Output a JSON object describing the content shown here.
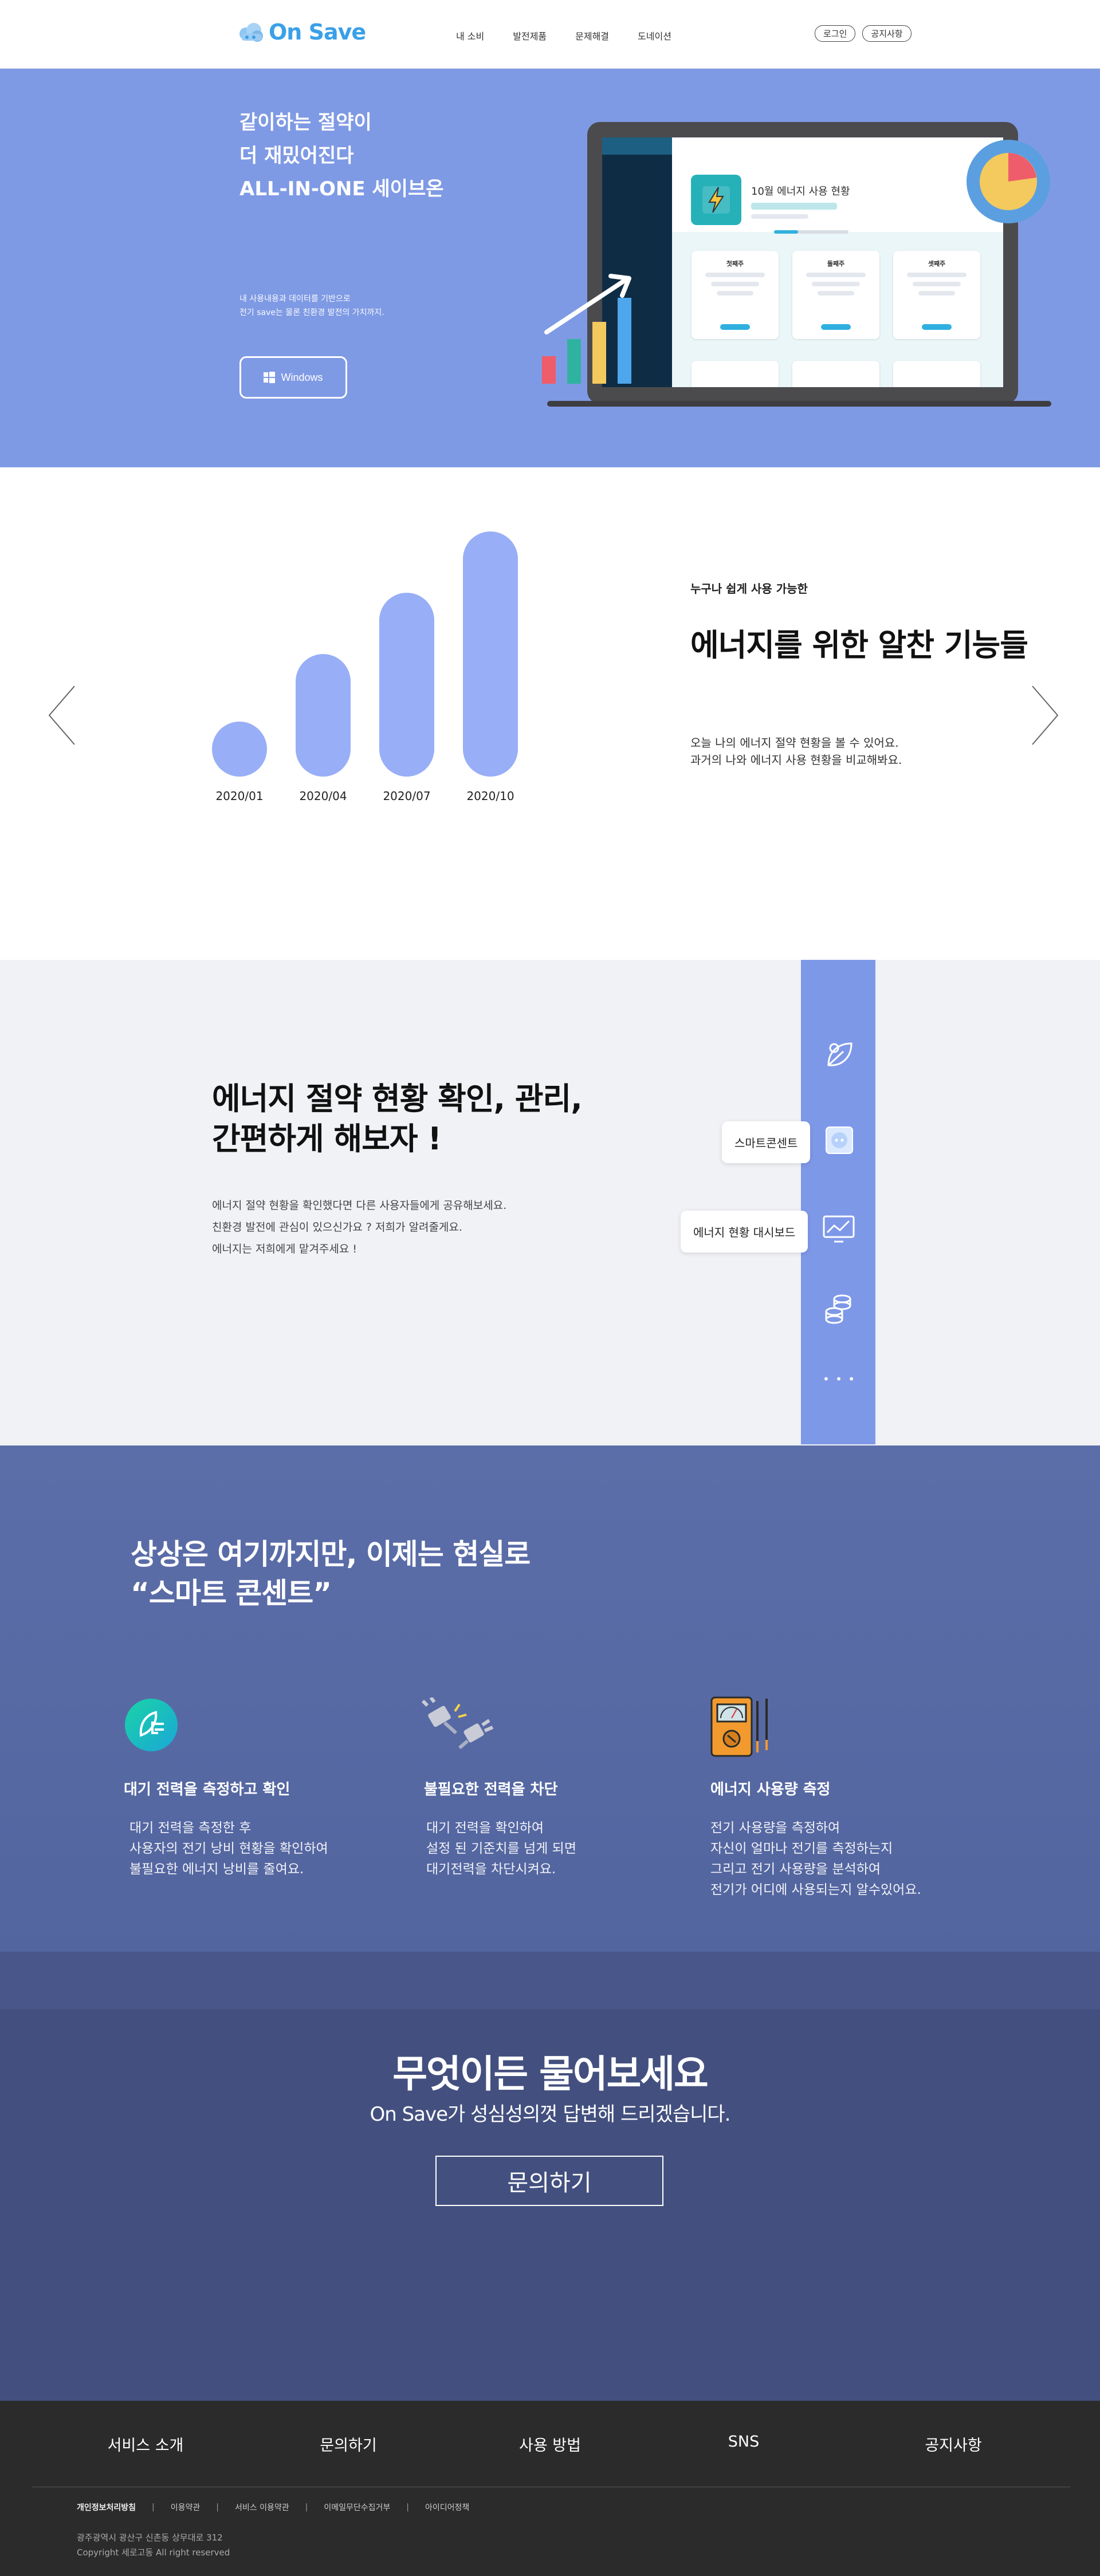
{
  "header": {
    "brand": "On Save",
    "nav": [
      "내 소비",
      "발전제품",
      "문제해결",
      "도네이션"
    ],
    "login": "로그인",
    "notice": "공지사항"
  },
  "hero": {
    "title_lines": [
      "같이하는 절약이",
      "더 재밌어진다",
      "ALL-IN-ONE 세이브온"
    ],
    "sub_lines": [
      "내 사용내용과 데이터를 기반으로",
      "전기 save는 물론 친환경 발전의 가치까지."
    ],
    "button": "Windows",
    "screen": {
      "title": "10월 에너지 사용 현황",
      "cards": [
        "첫째주",
        "둘째주",
        "셋째주"
      ]
    }
  },
  "features": {
    "kicker": "누구나 쉽게 사용 가능한",
    "title": "에너지를 위한 알찬 기능들",
    "desc_lines": [
      "오늘 나의 에너지 절약 현황을 볼 수 있어요.",
      "과거의 나와 에너지 사용 현황을 비교해봐요."
    ],
    "chart_data": {
      "type": "bar",
      "categories": [
        "2020/01",
        "2020/04",
        "2020/07",
        "2020/10"
      ],
      "values": [
        1,
        2,
        3,
        4
      ]
    }
  },
  "manage": {
    "title_lines": [
      "에너지 절약 현황 확인, 관리,",
      "간편하게 해보자 !"
    ],
    "desc_lines": [
      "에너지 절약 현황을 확인했다면 다른 사용자들에게 공유해보세요.",
      "친환경 발전에 관심이 있으신가요 ? 저희가 알려줄게요.",
      "에너지는 저희에게 맡겨주세요 !"
    ],
    "tags": [
      "스마트콘센트",
      "에너지 현황 대시보드"
    ],
    "more": "• • •"
  },
  "smart": {
    "title_lines": [
      "상상은 여기까지만, 이제는 현실로",
      "“스마트 콘센트”"
    ],
    "items": [
      {
        "title": "대기 전력을 측정하고 확인",
        "desc": [
          "대기 전력을 측정한 후",
          "사용자의 전기 낭비 현황을 확인하여",
          "불필요한 에너지 낭비를 줄여요."
        ],
        "icon": "plug-leaf-icon"
      },
      {
        "title": "불필요한 전력을 차단",
        "desc": [
          "대기 전력을 확인하여",
          "설정 된 기준치를 넘게 되면",
          "대기전력을 차단시켜요."
        ],
        "icon": "plugs-icon"
      },
      {
        "title": "에너지 사용량 측정",
        "desc": [
          "전기 사용량을 측정하여",
          "자신이 얼마나 전기를 측정하는지",
          "그리고 전기 사용량을 분석하여",
          "전기가 어디에 사용되는지 알수있어요."
        ],
        "icon": "multimeter-icon"
      }
    ]
  },
  "ask": {
    "title": "무엇이든 물어보세요",
    "sub": "On Save가 성심성의껏 답변해 드리겠습니다.",
    "button": "문의하기"
  },
  "footer": {
    "nav": [
      "서비스 소개",
      "문의하기",
      "사용 방법",
      "SNS",
      "공지사항"
    ],
    "links": [
      "개인정보처리방침",
      "이용약관",
      "서비스 이용약관",
      "이메일무단수집거부",
      "아이디어정책"
    ],
    "address": "광주광역시 광산구 신촌동 상무대로 312",
    "copyright": "Copyright  세로고동 All right reserved"
  },
  "colors": {
    "brand": "#3aa0e8",
    "hero_bg": "#7f9ae4",
    "bar": "#98aef7",
    "smart_bg": "#5c6ea9",
    "ask_bg": "#43507f",
    "footer_bg": "#2b2b2b"
  }
}
